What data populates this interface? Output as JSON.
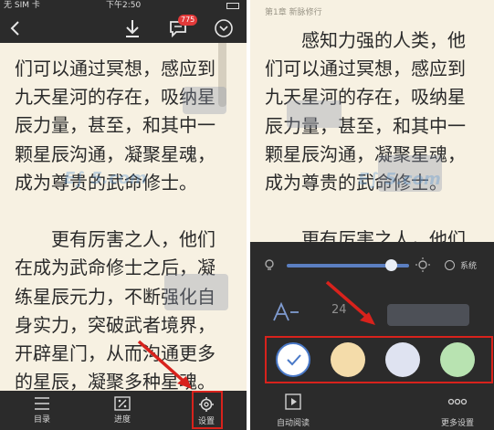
{
  "left": {
    "status": {
      "carrier": "无 SIM 卡",
      "time": "下午2:50"
    },
    "toolbar": {
      "comment_count": "775"
    },
    "paragraphs": [
      "们可以通过冥想，感应到",
      "九天星河的存在，吸纳星",
      "辰力量，甚至，和其中一",
      "颗星辰沟通，凝聚星魂，",
      "成为尊贵的武命修士。",
      "",
      "　　更有厉害之人，他们",
      "在成为武命修士之后，凝",
      "练星辰元力，不断强化自",
      "身实力，突破武者境界，",
      "开辟星门，从而沟通更多",
      "的星辰，凝聚多种星魂。"
    ],
    "bottom": {
      "toc": "目录",
      "progress": "进度",
      "settings": "设置"
    }
  },
  "right": {
    "chapter": "第1章 新脉修行",
    "paragraphs": [
      "　　感知力强的人类，他",
      "们可以通过冥想，感应到",
      "九天星河的存在，吸纳星",
      "辰力量，甚至，和其中一",
      "颗星辰沟通，凝聚星魂，",
      "成为尊贵的武命修士。",
      "",
      "　　更有厉害之人，他们"
    ],
    "settings": {
      "brightness": 0.85,
      "system_label": "系统",
      "font_size": "24",
      "themes": [
        "#ffffff",
        "#f4dcaa",
        "#dfe3f1",
        "#b8e3b1",
        "#f6c6cf"
      ],
      "auto_read": "自动阅读",
      "more_settings": "更多设置"
    }
  },
  "colors": {
    "accent_red": "#d8221c",
    "slider": "#5b7fc1",
    "bar": "#2b2b2b",
    "page": "#f7f1e2"
  }
}
